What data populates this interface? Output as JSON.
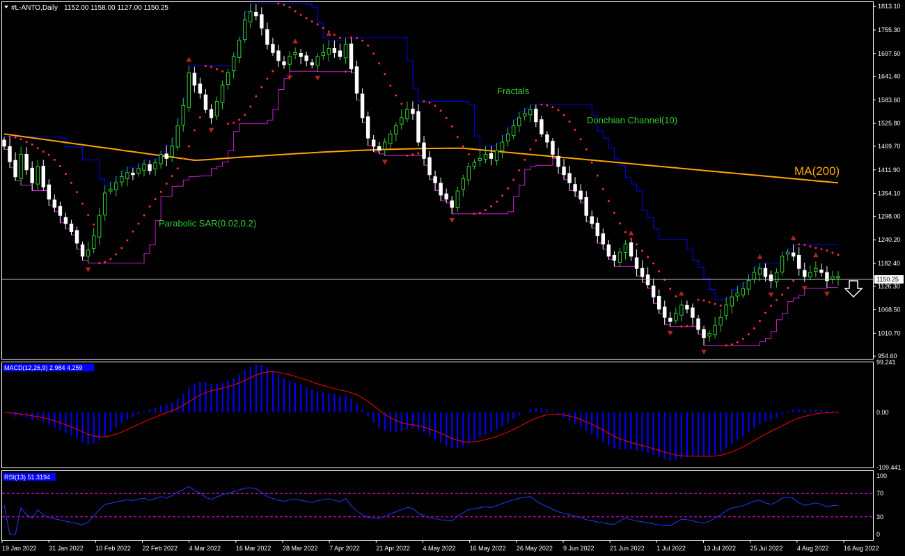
{
  "header": {
    "symbol": "#L-ANTO,Daily",
    "ohlc": "1152.00 1158.00 1127.00 1150.25"
  },
  "colors": {
    "background": "#000000",
    "frame": "#ffffff",
    "bull": "#32cd32",
    "bear": "#ffffff",
    "ma": "#ffa500",
    "donchian": "#0000ff",
    "sar": "#ff3030",
    "fractal": "#b22222",
    "annotation": "#32cd32",
    "macd_hist": "#0000ff",
    "macd_signal": "#ff0000",
    "rsi": "#1e3cff",
    "rsi_levels": "#ff00ff",
    "price_badge": "#ffffff"
  },
  "chart_data": [
    {
      "type": "candlestick",
      "panel": "price",
      "y_ticks": [
        "1813.10",
        "1755.30",
        "1697.50",
        "1641.40",
        "1583.60",
        "1525.80",
        "1469.70",
        "1411.90",
        "1354.10",
        "1298.00",
        "1240.20",
        "1182.40",
        "1126.30",
        "1068.50",
        "1010.70",
        "954.60"
      ],
      "ylim": [
        948,
        1822
      ],
      "current_price": "1150.25",
      "signal": "down-arrow",
      "annotations": [
        {
          "text": "Fractals",
          "near": "2022-06-01"
        },
        {
          "text": "Donchian Channel(10)",
          "near": "2022-06-13"
        },
        {
          "text": "MA(200)",
          "near": "2022-08-17"
        },
        {
          "text": "Parabolic SAR(0.02,0.2)",
          "near": "2022-02-25"
        }
      ],
      "x_ticks": [
        "19 Jan 2022",
        "31 Jan 2022",
        "10 Feb 2022",
        "22 Feb 2022",
        "4 Mar 2022",
        "16 Mar 2022",
        "28 Mar 2022",
        "7 Apr 2022",
        "21 Apr 2022",
        "4 May 2022",
        "16 May 2022",
        "26 May 2022",
        "9 Jun 2022",
        "21 Jun 2022",
        "1 Jul 2022",
        "13 Jul 2022",
        "25 Jul 2022",
        "4 Aug 2022",
        "16 Aug 2022"
      ],
      "closes": [
        1470,
        1432,
        1395,
        1450,
        1412,
        1380,
        1420,
        1370,
        1340,
        1320,
        1300,
        1280,
        1260,
        1232,
        1200,
        1215,
        1250,
        1300,
        1355,
        1365,
        1380,
        1395,
        1405,
        1400,
        1415,
        1425,
        1410,
        1430,
        1450,
        1440,
        1470,
        1520,
        1570,
        1650,
        1620,
        1600,
        1560,
        1540,
        1580,
        1620,
        1650,
        1690,
        1730,
        1780,
        1800,
        1790,
        1760,
        1720,
        1700,
        1680,
        1670,
        1690,
        1700,
        1690,
        1680,
        1670,
        1690,
        1700,
        1710,
        1700,
        1690,
        1720,
        1660,
        1600,
        1540,
        1490,
        1470,
        1460,
        1480,
        1500,
        1520,
        1540,
        1560,
        1550,
        1480,
        1440,
        1400,
        1380,
        1350,
        1340,
        1320,
        1360,
        1390,
        1420,
        1430,
        1440,
        1450,
        1440,
        1460,
        1480,
        1500,
        1520,
        1540,
        1550,
        1560,
        1530,
        1500,
        1480,
        1450,
        1420,
        1400,
        1380,
        1360,
        1340,
        1300,
        1280,
        1250,
        1230,
        1200,
        1190,
        1210,
        1230,
        1200,
        1170,
        1150,
        1130,
        1100,
        1070,
        1050,
        1040,
        1060,
        1080,
        1070,
        1050,
        1020,
        1000,
        1010,
        1030,
        1050,
        1080,
        1100,
        1110,
        1120,
        1140,
        1160,
        1170,
        1150,
        1140,
        1160,
        1200,
        1210,
        1200,
        1170,
        1150,
        1160,
        1170,
        1160,
        1140,
        1150,
        1150.25
      ]
    },
    {
      "type": "bar",
      "panel": "macd",
      "title": "MACD(12,26,9) 2.984 4.259",
      "y_ticks": [
        "99.241",
        "0.00",
        "-109.441"
      ],
      "ylim": [
        -109.441,
        99.241
      ]
    },
    {
      "type": "line",
      "panel": "rsi",
      "title": "RSI(13) 51.3194",
      "y_ticks": [
        "100",
        "70",
        "30",
        "0"
      ],
      "ylim": [
        0,
        100
      ],
      "levels": [
        70,
        30
      ]
    }
  ]
}
